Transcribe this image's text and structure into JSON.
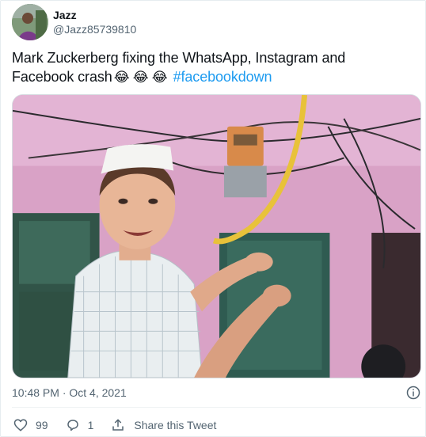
{
  "tweet": {
    "display_name": "Jazz",
    "handle": "@Jazz85739810",
    "text_main": "Mark Zuckerberg fixing the WhatsApp, Instagram and Facebook crash",
    "emojis": [
      "😂",
      "😂",
      "😂"
    ],
    "hashtag": "#facebookdown",
    "timestamp": "10:48 PM · Oct 4, 2021"
  },
  "actions": {
    "like_count": "99",
    "reply_count": "1",
    "share_label": "Share this Tweet"
  },
  "icons": {
    "like": "heart-icon",
    "reply": "reply-icon",
    "share": "share-icon",
    "info": "info-icon"
  },
  "colors": {
    "hashtag": "#1d9bf0",
    "secondary_text": "#536471"
  }
}
